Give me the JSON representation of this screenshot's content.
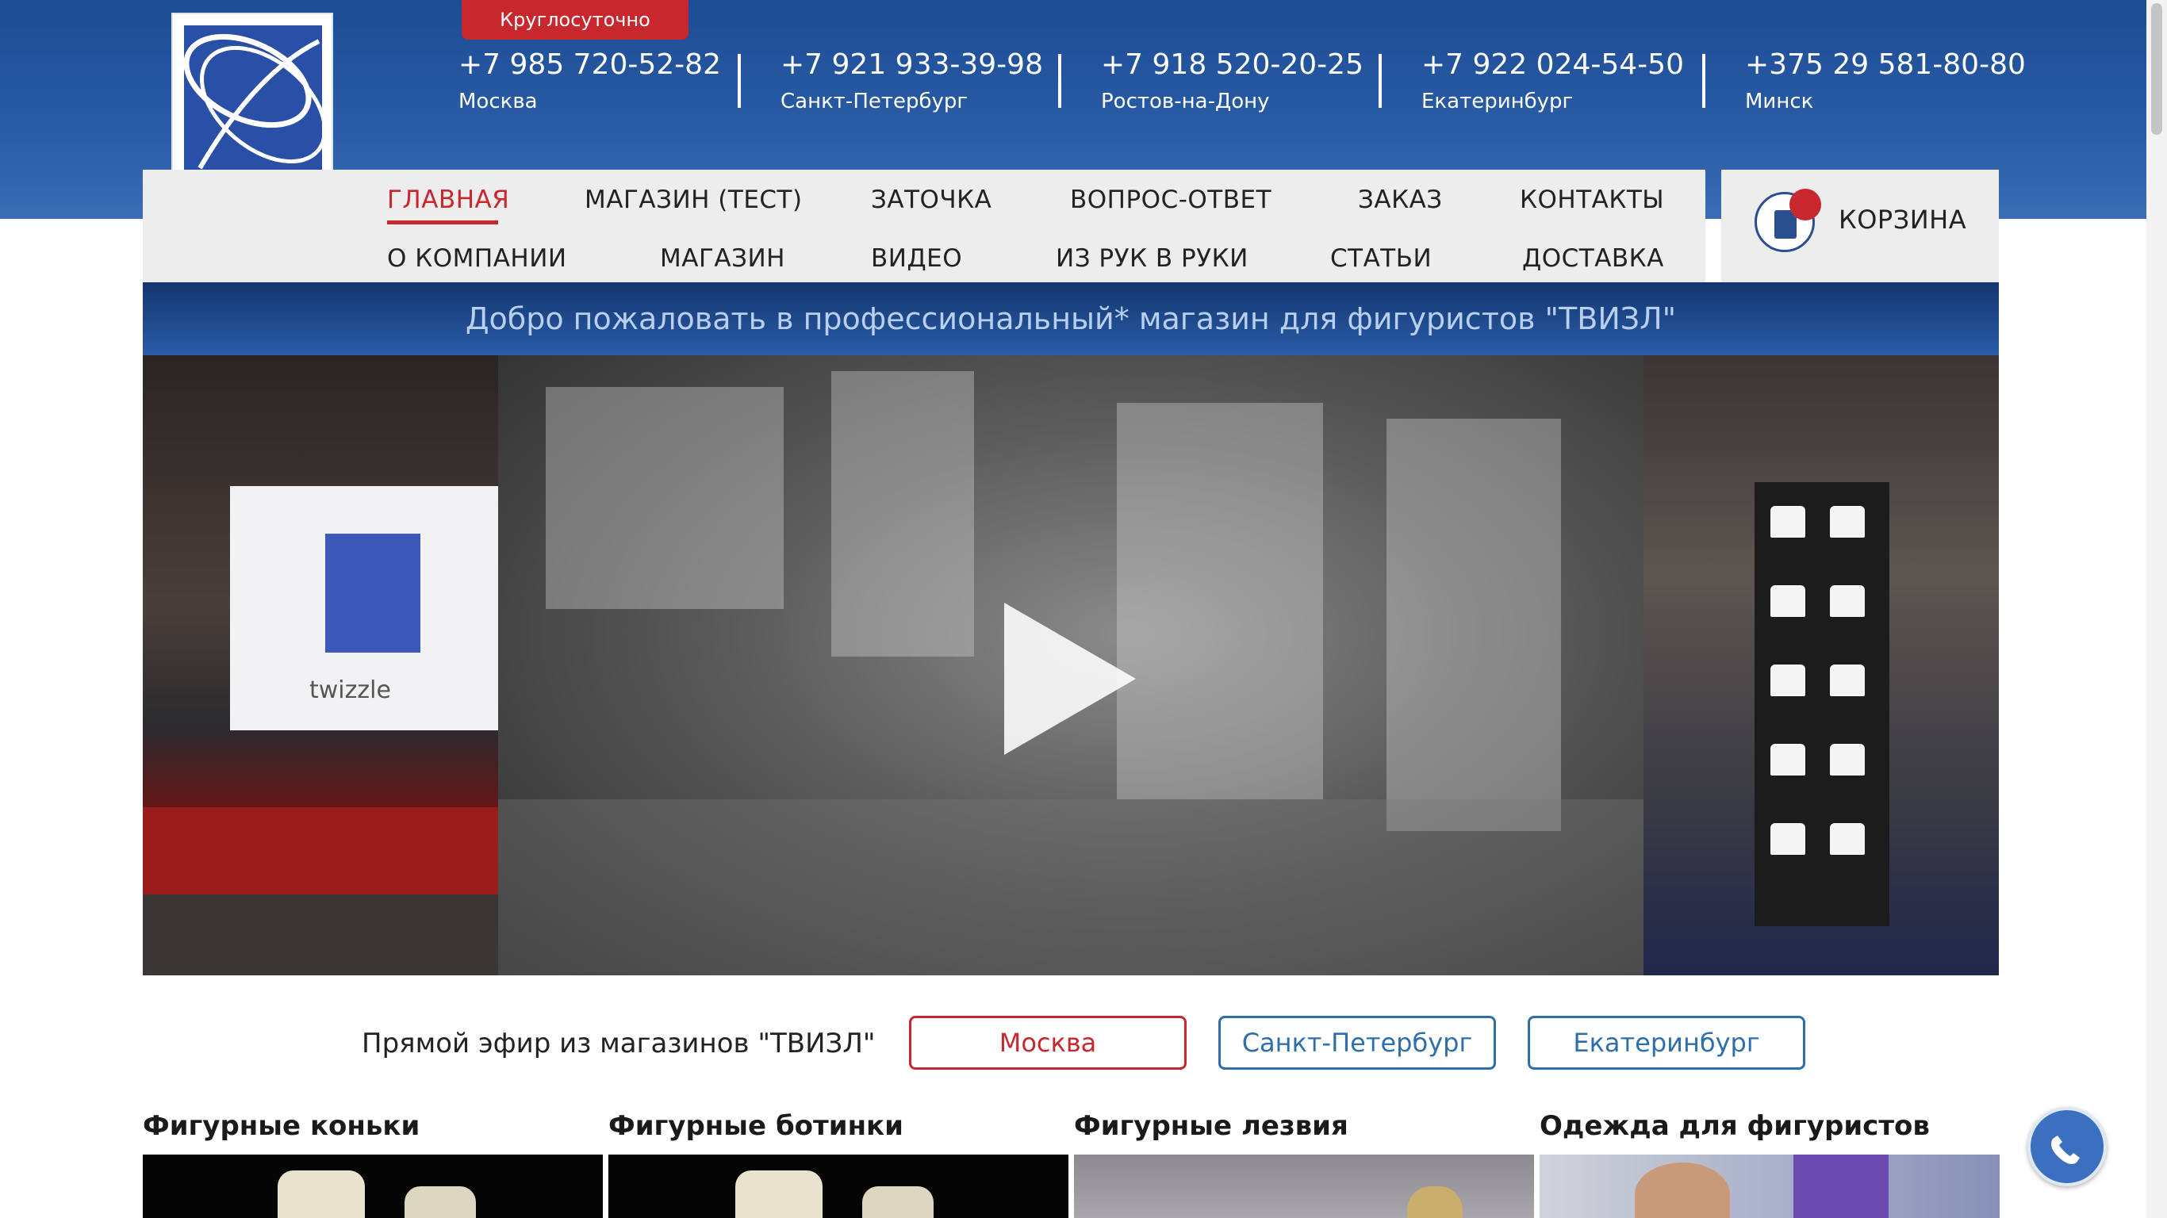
{
  "header": {
    "badge": "Круглосуточно",
    "logo_text": "twizzle",
    "phones": [
      {
        "number": "+7 985 720-52-82",
        "city": "Москва"
      },
      {
        "number": "+7 921 933-39-98",
        "city": "Санкт-Петербург"
      },
      {
        "number": "+7 918 520-20-25",
        "city": "Ростов-на-Дону"
      },
      {
        "number": "+7 922 024-54-50",
        "city": "Екатеринбург"
      },
      {
        "number": "+375 29 581-80-80",
        "city": "Минск"
      }
    ]
  },
  "nav": {
    "row1": [
      "ГЛАВНАЯ",
      "МАГАЗИН (ТЕСТ)",
      "ЗАТОЧКА",
      "ВОПРОС-ОТВЕТ",
      "ЗАКАЗ",
      "КОНТАКТЫ"
    ],
    "row2": [
      "О КОМПАНИИ",
      "МАГАЗИН",
      "ВИДЕО",
      "ИЗ РУК В РУКИ",
      "СТАТЬИ",
      "ДОСТАВКА"
    ],
    "active": "ГЛАВНАЯ"
  },
  "cart": {
    "label": "КОРЗИНА"
  },
  "welcome": "Добро пожаловать в профессиональный* магазин для фигуристов \"ТВИЗЛ\"",
  "banner": {
    "flag_text": "twizzle"
  },
  "live": {
    "label": "Прямой эфир из магазинов \"ТВИЗЛ\"",
    "cities": [
      "Москва",
      "Санкт-Петербург",
      "Екатеринбург"
    ],
    "active": "Москва"
  },
  "categories": [
    "Фигурные коньки",
    "Фигурные ботинки",
    "Фигурные лезвия",
    "Одежда для фигуристов"
  ],
  "colors": {
    "brand_blue": "#2a5ca7",
    "accent_red": "#c8282d",
    "button_blue": "#2e6fab"
  },
  "icons": {
    "cart": "cart-icon",
    "play": "play-icon",
    "phone": "phone-icon"
  }
}
